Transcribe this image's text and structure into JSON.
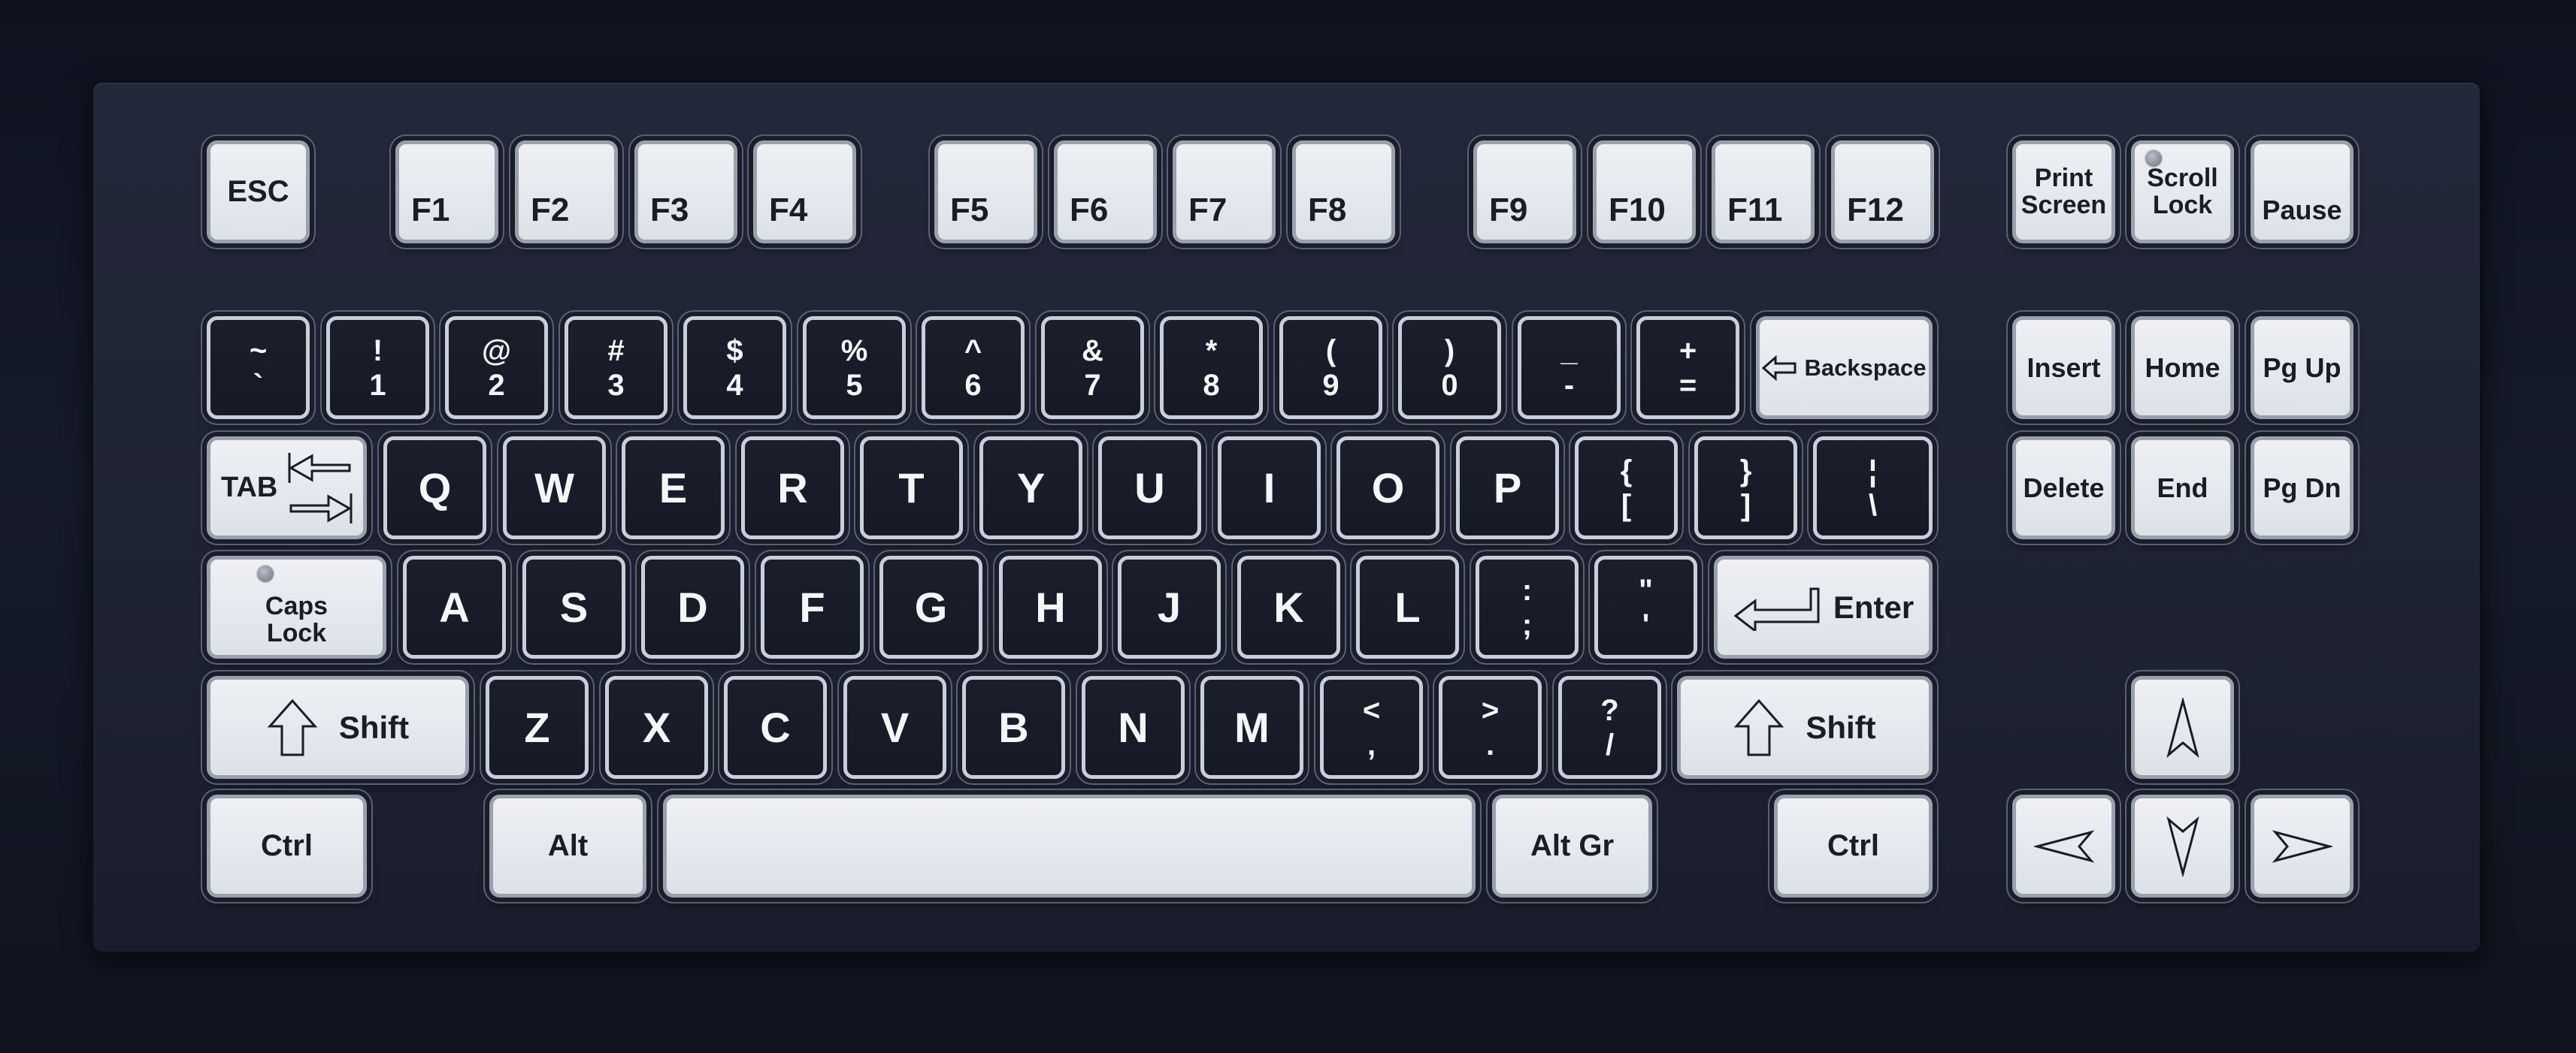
{
  "function_row": {
    "esc": "ESC",
    "f1": "F1",
    "f2": "F2",
    "f3": "F3",
    "f4": "F4",
    "f5": "F5",
    "f6": "F6",
    "f7": "F7",
    "f8": "F8",
    "f9": "F9",
    "f10": "F10",
    "f11": "F11",
    "f12": "F12",
    "print_screen": [
      "Print",
      "Screen"
    ],
    "scroll_lock": [
      "Scroll",
      "Lock"
    ],
    "pause": "Pause"
  },
  "number_row": [
    {
      "top": "~",
      "bottom": "`"
    },
    {
      "top": "!",
      "bottom": "1"
    },
    {
      "top": "@",
      "bottom": "2"
    },
    {
      "top": "#",
      "bottom": "3"
    },
    {
      "top": "$",
      "bottom": "4"
    },
    {
      "top": "%",
      "bottom": "5"
    },
    {
      "top": "^",
      "bottom": "6"
    },
    {
      "top": "&",
      "bottom": "7"
    },
    {
      "top": "*",
      "bottom": "8"
    },
    {
      "top": "(",
      "bottom": "9"
    },
    {
      "top": ")",
      "bottom": "0"
    },
    {
      "top": "_",
      "bottom": "-"
    },
    {
      "top": "+",
      "bottom": "="
    }
  ],
  "backspace": "Backspace",
  "tab": "TAB",
  "qwerty_row": [
    "Q",
    "W",
    "E",
    "R",
    "T",
    "Y",
    "U",
    "I",
    "O",
    "P"
  ],
  "qwerty_symbols": [
    {
      "top": "{",
      "bottom": "["
    },
    {
      "top": "}",
      "bottom": "]"
    },
    {
      "top": "¦",
      "bottom": "\\"
    }
  ],
  "caps_lock": [
    "Caps",
    "Lock"
  ],
  "home_row": [
    "A",
    "S",
    "D",
    "F",
    "G",
    "H",
    "J",
    "K",
    "L"
  ],
  "home_symbols": [
    {
      "top": ":",
      "bottom": ";"
    },
    {
      "top": "\"",
      "bottom": "'"
    }
  ],
  "enter": "Enter",
  "shift": "Shift",
  "bottom_letters": [
    "Z",
    "X",
    "C",
    "V",
    "B",
    "N",
    "M"
  ],
  "bottom_symbols": [
    {
      "top": "<",
      "bottom": ","
    },
    {
      "top": ">",
      "bottom": "."
    },
    {
      "top": "?",
      "bottom": "/"
    }
  ],
  "ctrl": "Ctrl",
  "alt": "Alt",
  "alt_gr": "Alt Gr",
  "nav": {
    "insert": "Insert",
    "home": "Home",
    "pg_up": "Pg Up",
    "delete": "Delete",
    "end": "End",
    "pg_dn": "Pg Dn"
  },
  "icons": {
    "arrow_up": "arrow-up-icon",
    "arrow_down": "arrow-down-icon",
    "arrow_left": "arrow-left-icon",
    "arrow_right": "arrow-right-icon",
    "shift": "shift-arrow-icon",
    "enter": "enter-arrow-icon",
    "backspace": "backspace-arrow-icon",
    "tab": "tab-arrows-icon"
  },
  "colors": {
    "keycap_light": "#e4e7ed",
    "keycap_dark": "#181c28",
    "plate": "#20253a"
  }
}
